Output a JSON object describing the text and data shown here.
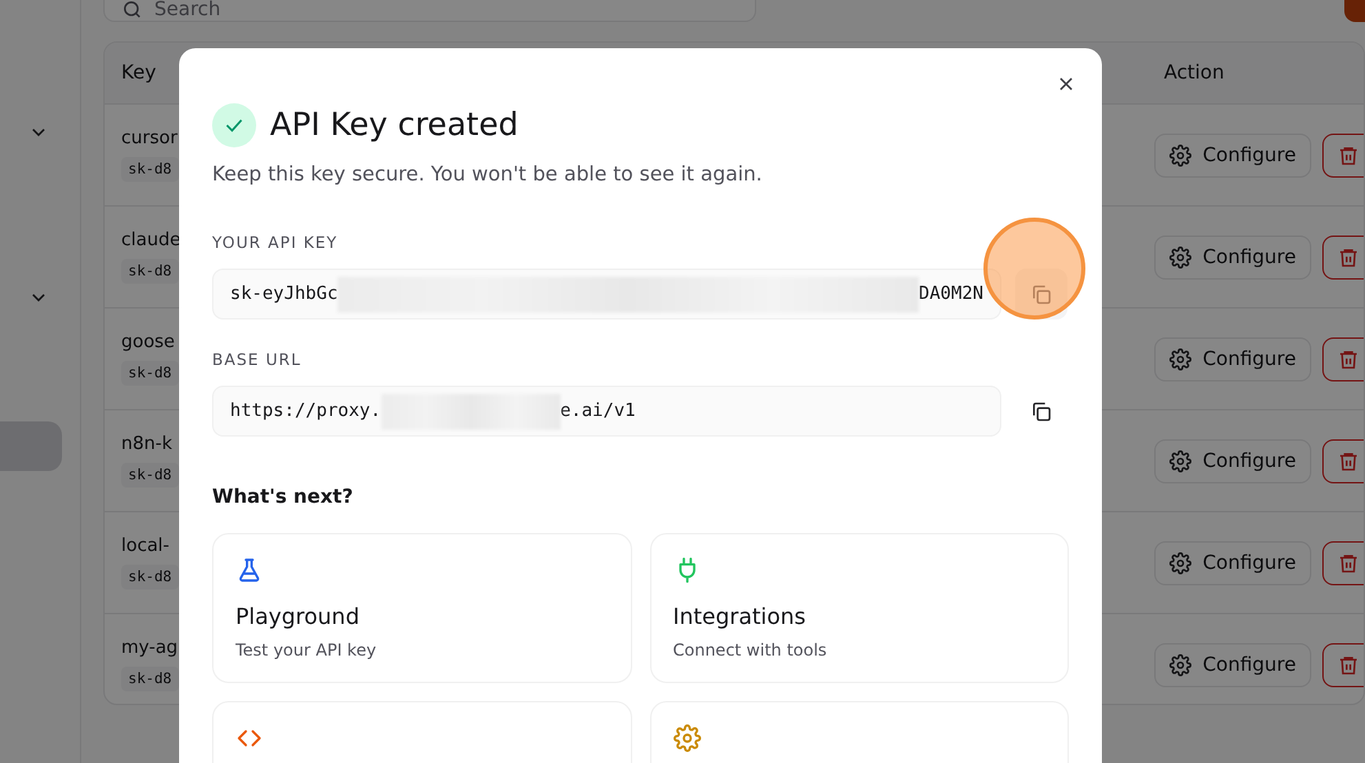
{
  "sidebar": {
    "items": [
      {
        "kind": "group"
      },
      {
        "kind": "group"
      },
      {
        "kind": "item",
        "selected": true
      }
    ]
  },
  "search": {
    "placeholder": "Search"
  },
  "table": {
    "columns": [
      "Key",
      "Action"
    ],
    "rows": [
      {
        "name": "cursor",
        "key_prefix": "sk-d8",
        "action": "Configure"
      },
      {
        "name": "claude",
        "key_prefix": "sk-d8",
        "action": "Configure"
      },
      {
        "name": "goose",
        "key_prefix": "sk-d8",
        "action": "Configure"
      },
      {
        "name": "n8n-k",
        "key_prefix": "sk-d8",
        "action": "Configure"
      },
      {
        "name": "local-",
        "key_prefix": "sk-d8",
        "action": "Configure"
      },
      {
        "name": "my-ag",
        "key_prefix": "sk-d8",
        "action": "Configure"
      }
    ]
  },
  "dialog": {
    "title": "API Key created",
    "subtitle": "Keep this key secure. You won't be able to see it again.",
    "fields": [
      {
        "label": "YOUR API KEY",
        "value_start": "sk-eyJhbGc",
        "value_end": "DA0M2N",
        "highlighted": true
      },
      {
        "label": "BASE URL",
        "value_start": "https://proxy.",
        "value_end": "e.ai/v1",
        "highlighted": false
      }
    ],
    "next_heading": "What's next?",
    "cards": [
      {
        "kind": "flask",
        "title": "Playground",
        "description": "Test your API key"
      },
      {
        "kind": "plug",
        "title": "Integrations",
        "description": "Connect with tools"
      },
      {
        "kind": "code"
      },
      {
        "kind": "gear"
      }
    ]
  }
}
